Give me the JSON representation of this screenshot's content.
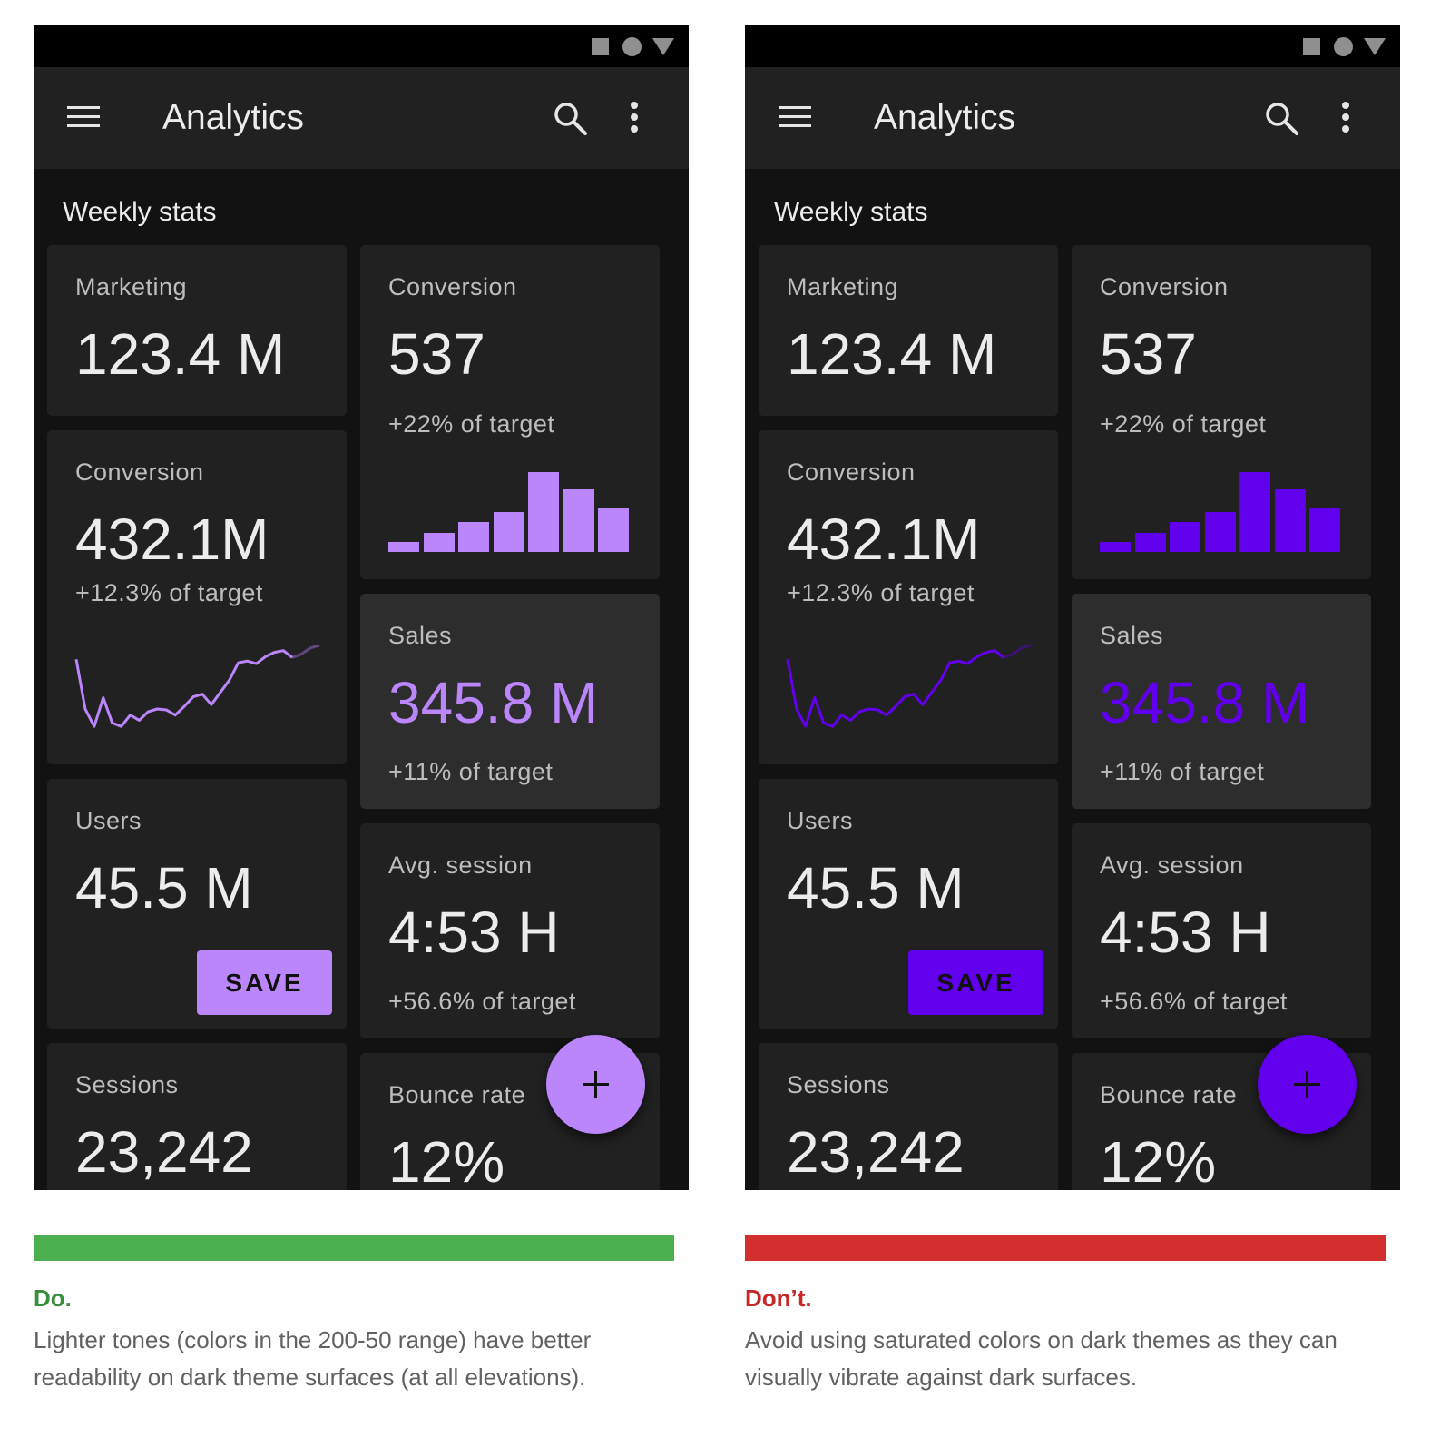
{
  "colors": {
    "do_accent": "#bb86fc",
    "dont_accent": "#6200ee",
    "do_bar": "#4caf50",
    "dont_bar": "#d32f2f",
    "do_title": "#388e3c",
    "dont_title": "#c62828"
  },
  "icons": {
    "menu": "menu-icon",
    "search": "search-icon",
    "more": "more-vert-icon",
    "fab": "add-icon"
  },
  "app": {
    "title": "Analytics",
    "section_title": "Weekly stats",
    "cards": {
      "marketing": {
        "label": "Marketing",
        "value": "123.4 M"
      },
      "conversion_large": {
        "label": "Conversion",
        "value": "432.1M",
        "sub": "+12.3% of target"
      },
      "users": {
        "label": "Users",
        "value": "45.5 M",
        "button": "SAVE"
      },
      "sessions": {
        "label": "Sessions",
        "value": "23,242"
      },
      "conversion_small": {
        "label": "Conversion",
        "value": "537",
        "sub": "+22% of target"
      },
      "sales": {
        "label": "Sales",
        "value": "345.8 M",
        "sub": "+11% of target"
      },
      "avg_session": {
        "label": "Avg. session",
        "value": "4:53 H",
        "sub": "+56.6% of target"
      },
      "bounce_rate": {
        "label": "Bounce rate",
        "value": "12%"
      }
    }
  },
  "mini_bar_values": [
    13,
    24,
    37,
    50,
    100,
    78,
    55
  ],
  "sparkline_values": [
    82,
    25,
    5,
    38,
    9,
    5,
    18,
    12,
    22,
    25,
    24,
    18,
    28,
    39,
    42,
    30,
    44,
    58,
    78,
    80,
    77,
    85,
    90,
    92,
    84,
    88,
    95,
    98
  ],
  "do": {
    "title": "Do.",
    "text": "Lighter tones (colors in the 200-50 range) have better readability on dark theme surfaces (at all elevations)."
  },
  "dont": {
    "title": "Don’t.",
    "text": "Avoid using saturated colors on dark themes as they can visually vibrate against dark surfaces."
  }
}
